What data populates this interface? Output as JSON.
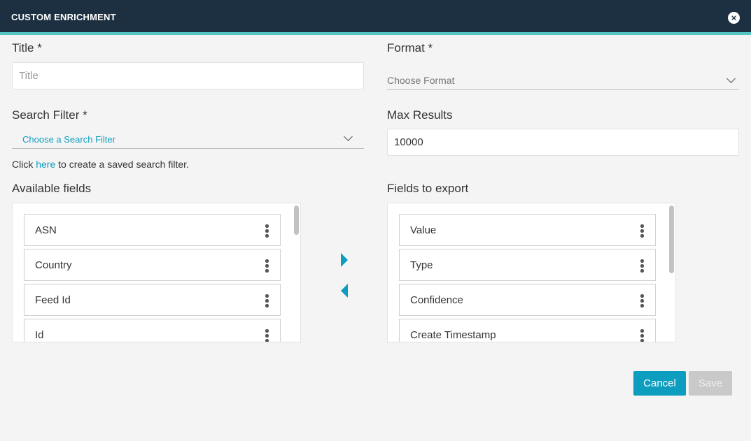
{
  "header": {
    "title": "CUSTOM ENRICHMENT",
    "close_glyph": "×"
  },
  "title_field": {
    "label": "Title *",
    "placeholder": "Title",
    "value": ""
  },
  "format_field": {
    "label": "Format *",
    "selected": "Choose Format"
  },
  "search_filter": {
    "label": "Search Filter *",
    "selected": "Choose a Search Filter",
    "helper_prefix": "Click ",
    "helper_link": "here",
    "helper_suffix": " to create a saved search filter."
  },
  "max_results": {
    "label": "Max Results",
    "value": "10000"
  },
  "available_fields": {
    "label": "Available fields",
    "items": [
      "ASN",
      "Country",
      "Feed Id",
      "Id"
    ]
  },
  "export_fields": {
    "label": "Fields to export",
    "items": [
      "Value",
      "Type",
      "Confidence",
      "Create Timestamp"
    ]
  },
  "icons": {
    "close": "close-icon",
    "dropdown": "chevron-down-icon",
    "drag": "kebab-menu-icon",
    "move_right": "caret-right-icon",
    "move_left": "caret-left-icon"
  },
  "colors": {
    "header_bg": "#1d3041",
    "header_accent": "#56c5c5",
    "primary": "#0d9ebf",
    "disabled": "#c9c9c9"
  },
  "footer": {
    "cancel_label": "Cancel",
    "save_label": "Save"
  }
}
